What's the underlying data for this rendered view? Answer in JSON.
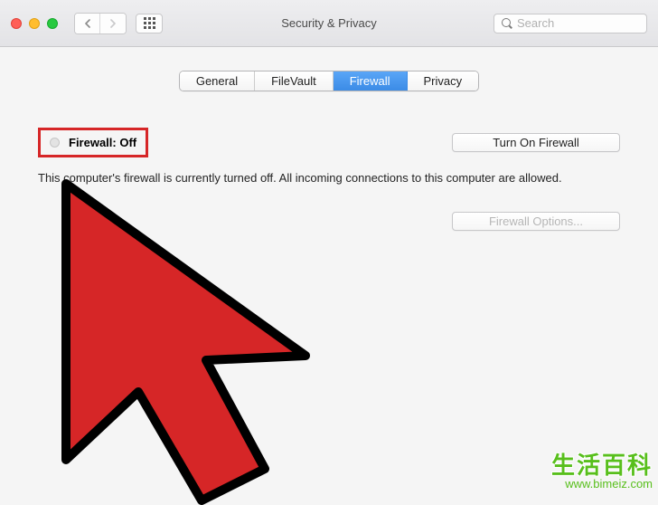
{
  "window": {
    "title": "Security & Privacy"
  },
  "search": {
    "placeholder": "Search"
  },
  "tabs": {
    "items": [
      {
        "label": "General"
      },
      {
        "label": "FileVault"
      },
      {
        "label": "Firewall"
      },
      {
        "label": "Privacy"
      }
    ],
    "active_index": 2
  },
  "firewall": {
    "status_label": "Firewall: Off",
    "turn_on_label": "Turn On Firewall",
    "description": "This computer's firewall is currently turned off. All incoming connections to this computer are allowed.",
    "options_label": "Firewall Options..."
  },
  "watermark": {
    "cn": "生活百科",
    "url": "www.bimeiz.com"
  },
  "annotation": {
    "cursor_color": "#d62627",
    "highlight_box_color": "#d62627"
  }
}
